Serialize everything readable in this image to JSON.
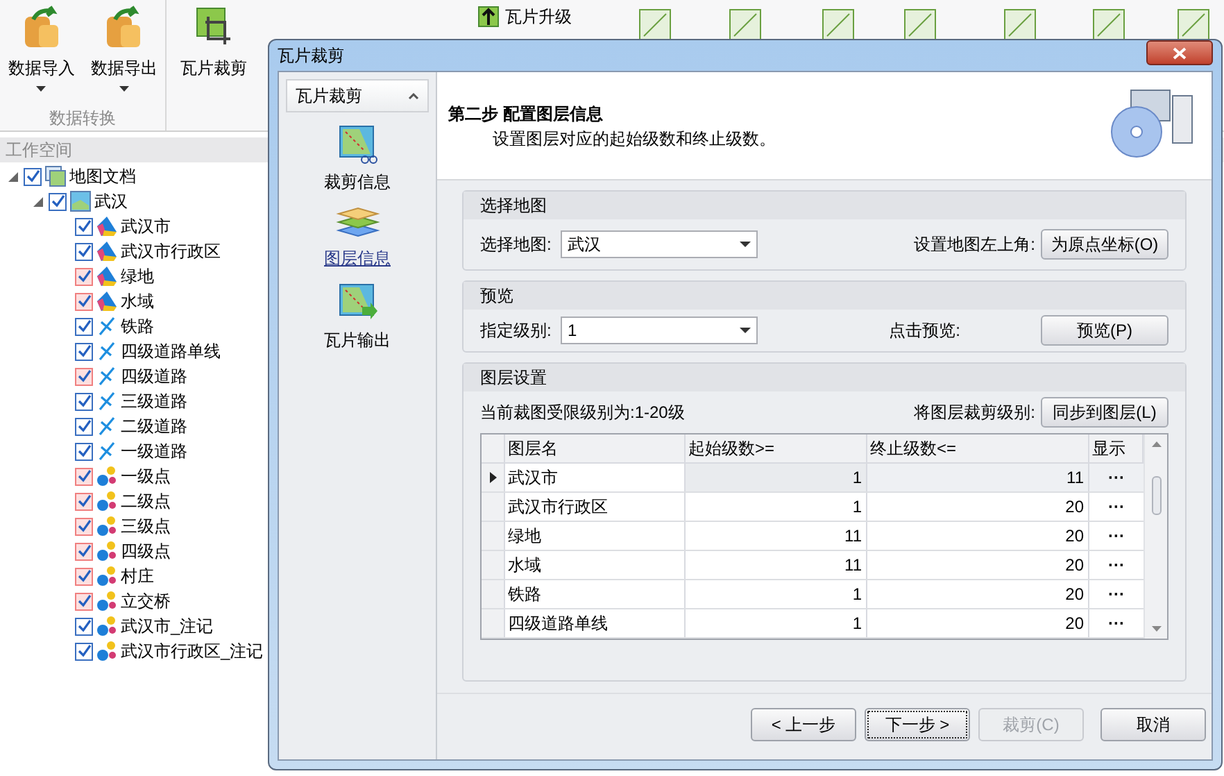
{
  "ribbon": {
    "buttons": [
      {
        "label": "数据导入",
        "dropdown": true
      },
      {
        "label": "数据导出",
        "dropdown": true
      }
    ],
    "group_label": "数据转换",
    "crop_button": {
      "label": "瓦片裁剪"
    },
    "small_button": {
      "label": "瓦片升级"
    }
  },
  "workspace": {
    "title": "工作空间",
    "tree": [
      {
        "label": "地图文档",
        "kind": "document",
        "checked": true,
        "flagged": false,
        "expanded": true,
        "children": [
          {
            "label": "武汉",
            "kind": "map",
            "checked": true,
            "flagged": false,
            "expanded": true,
            "children": [
              {
                "label": "武汉市",
                "kind": "region",
                "checked": true,
                "flagged": false
              },
              {
                "label": "武汉市行政区",
                "kind": "region",
                "checked": true,
                "flagged": false
              },
              {
                "label": "绿地",
                "kind": "region",
                "checked": true,
                "flagged": true
              },
              {
                "label": "水域",
                "kind": "region",
                "checked": true,
                "flagged": true
              },
              {
                "label": "铁路",
                "kind": "line",
                "checked": true,
                "flagged": false
              },
              {
                "label": "四级道路单线",
                "kind": "line",
                "checked": true,
                "flagged": false
              },
              {
                "label": "四级道路",
                "kind": "line",
                "checked": true,
                "flagged": true
              },
              {
                "label": "三级道路",
                "kind": "line",
                "checked": true,
                "flagged": false
              },
              {
                "label": "二级道路",
                "kind": "line",
                "checked": true,
                "flagged": false
              },
              {
                "label": "一级道路",
                "kind": "line",
                "checked": true,
                "flagged": false
              },
              {
                "label": "一级点",
                "kind": "point",
                "checked": true,
                "flagged": true
              },
              {
                "label": "二级点",
                "kind": "point",
                "checked": true,
                "flagged": true
              },
              {
                "label": "三级点",
                "kind": "point",
                "checked": true,
                "flagged": true
              },
              {
                "label": "四级点",
                "kind": "point",
                "checked": true,
                "flagged": true
              },
              {
                "label": "村庄",
                "kind": "point",
                "checked": true,
                "flagged": true
              },
              {
                "label": "立交桥",
                "kind": "point",
                "checked": true,
                "flagged": true
              },
              {
                "label": "武汉市_注记",
                "kind": "point",
                "checked": true,
                "flagged": false
              },
              {
                "label": "武汉市行政区_注记",
                "kind": "point",
                "checked": true,
                "flagged": false
              }
            ]
          }
        ]
      }
    ]
  },
  "dialog": {
    "title": "瓦片裁剪",
    "nav": {
      "header": "瓦片裁剪",
      "items": [
        {
          "label": "裁剪信息",
          "kind": "crop",
          "selected": false
        },
        {
          "label": "图层信息",
          "kind": "layers",
          "selected": true
        },
        {
          "label": "瓦片输出",
          "kind": "output",
          "selected": false
        }
      ]
    },
    "step_title": "第二步 配置图层信息",
    "step_subtitle": "设置图层对应的起始级数和终止级数。",
    "map_group": {
      "title": "选择地图",
      "label": "选择地图:",
      "value": "武汉",
      "right_label": "设置地图左上角:",
      "button": "为原点坐标(O)"
    },
    "preview_group": {
      "title": "预览",
      "label": "指定级别:",
      "value": "1",
      "right_label": "点击预览:",
      "button": "预览(P)"
    },
    "layer_group": {
      "title": "图层设置",
      "note": "当前裁图受限级别为:1-20级",
      "right_label": "将图层裁剪级别:",
      "button": "同步到图层(L)",
      "table": {
        "columns": [
          "图层名",
          "起始级数>=",
          "终止级数<=",
          "显示"
        ],
        "rows": [
          {
            "name": "武汉市",
            "start": "1",
            "end": "11",
            "show": "···",
            "selected": true
          },
          {
            "name": "武汉市行政区",
            "start": "1",
            "end": "20",
            "show": "···",
            "selected": false
          },
          {
            "name": "绿地",
            "start": "11",
            "end": "20",
            "show": "···",
            "selected": false
          },
          {
            "name": "水域",
            "start": "11",
            "end": "20",
            "show": "···",
            "selected": false
          },
          {
            "name": "铁路",
            "start": "1",
            "end": "20",
            "show": "···",
            "selected": false
          },
          {
            "name": "四级道路单线",
            "start": "1",
            "end": "20",
            "show": "···",
            "selected": false
          }
        ]
      }
    },
    "buttons": [
      {
        "label": "< 上一步",
        "focused": false,
        "disabled": false
      },
      {
        "label": "下一步 >",
        "focused": true,
        "disabled": false
      },
      {
        "label": "裁剪(C)",
        "focused": false,
        "disabled": true
      },
      {
        "label": "取消",
        "focused": false,
        "disabled": false
      }
    ]
  }
}
